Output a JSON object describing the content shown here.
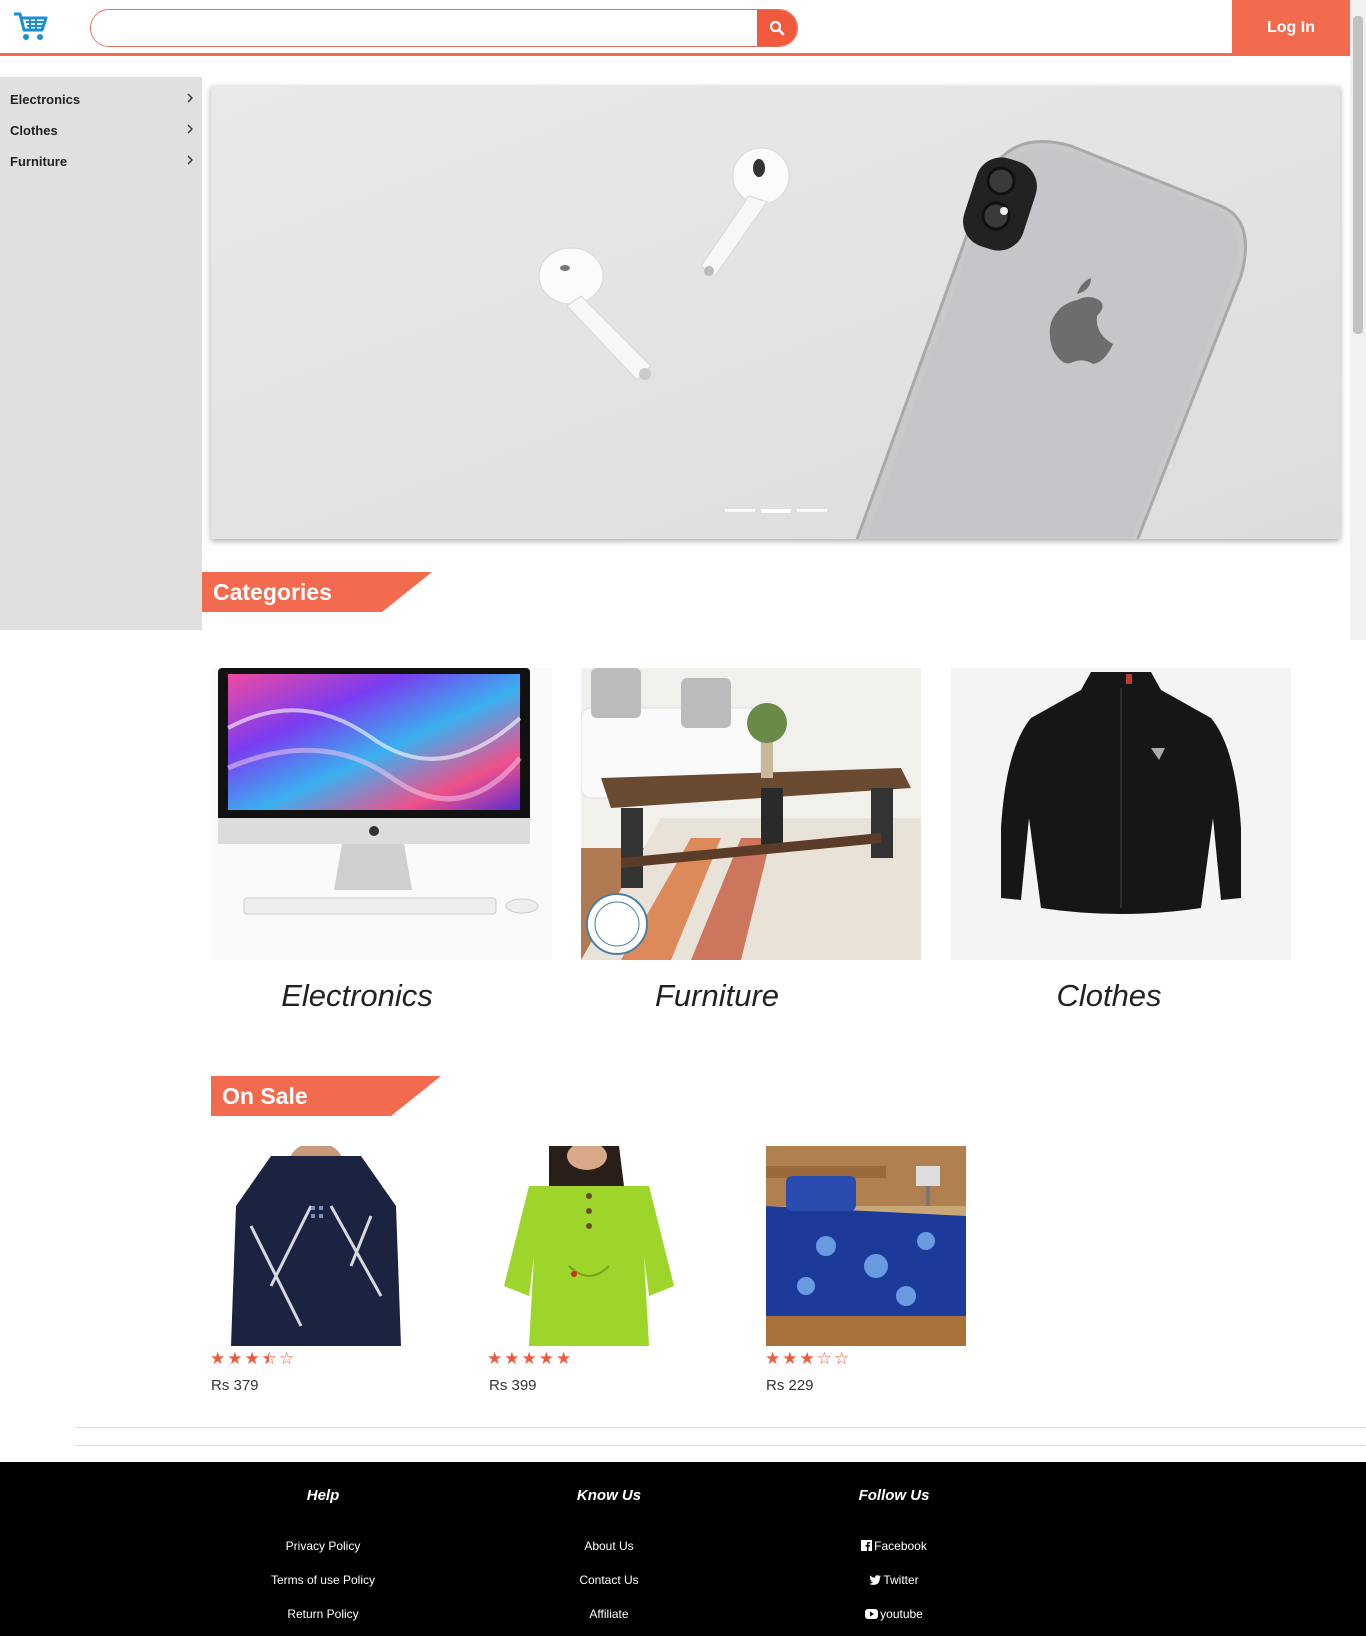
{
  "header": {
    "search_placeholder": "",
    "login_label": "Log In"
  },
  "sidebar": {
    "items": [
      {
        "label": "Electronics"
      },
      {
        "label": "Clothes"
      },
      {
        "label": "Furniture"
      }
    ]
  },
  "hero": {
    "slide_count": 3,
    "active_slide": 2
  },
  "categories": {
    "title": "Categories",
    "items": [
      {
        "label": "Electronics"
      },
      {
        "label": "Furniture"
      },
      {
        "label": "Clothes"
      }
    ]
  },
  "on_sale": {
    "title": "On Sale",
    "items": [
      {
        "price": "Rs 379",
        "rating": 3.5
      },
      {
        "price": "Rs 399",
        "rating": 5
      },
      {
        "price": "Rs 229",
        "rating": 3
      }
    ]
  },
  "footer": {
    "columns": [
      {
        "heading": "Help",
        "links": [
          "Privacy Policy",
          "Terms of use Policy",
          "Return Policy"
        ]
      },
      {
        "heading": "Know Us",
        "links": [
          "About Us",
          "Contact Us",
          "Affiliate"
        ]
      },
      {
        "heading": "Follow Us",
        "links": [
          "Facebook",
          "Twitter",
          "youtube"
        ]
      }
    ]
  },
  "colors": {
    "accent": "#f26b4f",
    "search_button": "#f05a3c",
    "sidebar_bg": "#e0e0e0",
    "footer_bg": "#000000",
    "cart_icon": "#1a8fd6"
  },
  "icons": {
    "logo": "shopping-cart-icon",
    "search": "search-icon",
    "sidebar_chevron": "chevron-right-icon",
    "star_full": "star-filled-icon",
    "star_half": "star-half-icon",
    "star_empty": "star-empty-icon",
    "facebook": "facebook-icon",
    "twitter": "twitter-icon",
    "youtube": "youtube-icon"
  }
}
